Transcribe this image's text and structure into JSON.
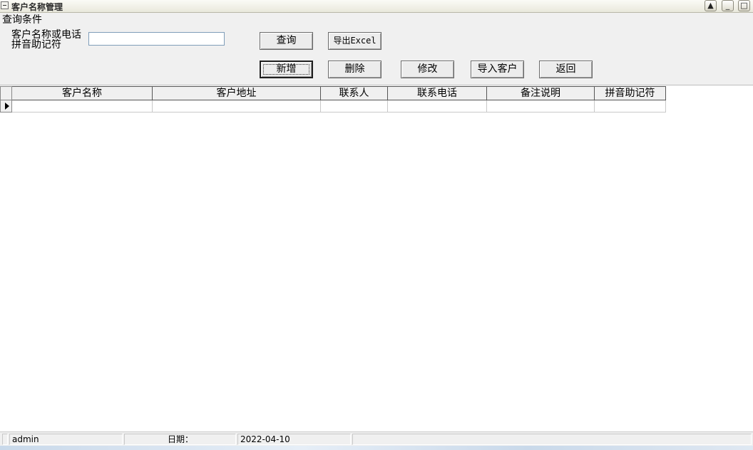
{
  "window": {
    "title": "客户名称管理"
  },
  "query": {
    "group_label": "查询条件",
    "field_label_line1": "客户名称或电话",
    "field_label_line2": "拼音助记符",
    "field_value": "",
    "field_placeholder": ""
  },
  "buttons": {
    "search": "查询",
    "export": "导出Excel",
    "add": "新增",
    "delete": "删除",
    "edit": "修改",
    "import": "导入客户",
    "back": "返回"
  },
  "grid": {
    "columns": [
      "客户名称",
      "客户地址",
      "联系人",
      "联系电话",
      "备注说明",
      "拼音助记符"
    ],
    "rows": [
      [
        "",
        "",
        "",
        "",
        "",
        ""
      ]
    ]
  },
  "status": {
    "user": "admin",
    "date_label": "日期：",
    "date_value": "2022-04-10"
  }
}
